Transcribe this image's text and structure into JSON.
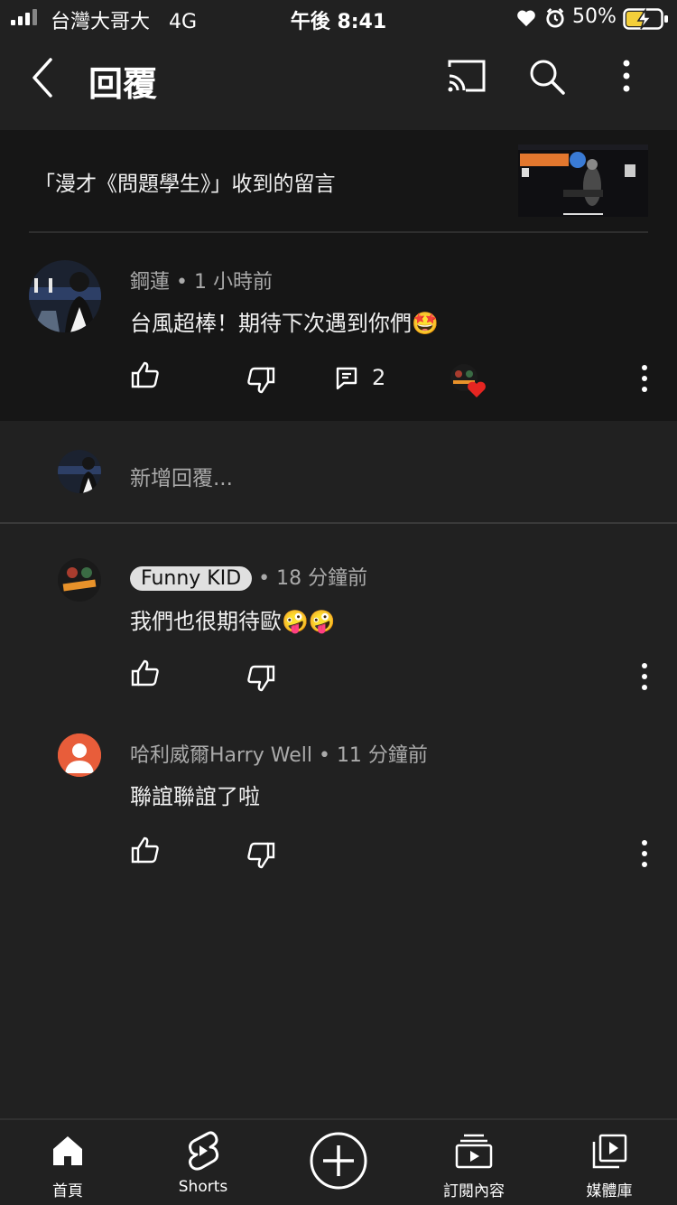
{
  "status_bar": {
    "carrier": "台灣大哥大",
    "network": "4G",
    "time": "午後 8:41",
    "battery": "50%"
  },
  "header": {
    "title": "回覆",
    "icons": [
      "back-arrow-icon",
      "cast-icon",
      "search-icon",
      "more-vertical-icon"
    ]
  },
  "video": {
    "title": "「漫才《問題學生》」收到的留言"
  },
  "main_comment": {
    "author": "鋼蓮",
    "time": "1 小時前",
    "text": "台風超棒！期待下次遇到你們🤩",
    "reply_count": "2"
  },
  "add_reply": {
    "placeholder": "新增回覆..."
  },
  "replies": [
    {
      "author": "Funny KID",
      "time": "18 分鐘前",
      "text": "我們也很期待歐🤪🤪"
    },
    {
      "author": "哈利威爾Harry Well",
      "time": "11 分鐘前",
      "text": "聯誼聯誼了啦"
    }
  ],
  "bottom_nav": {
    "items": [
      {
        "label": "首頁",
        "icon": "home-icon"
      },
      {
        "label": "Shorts",
        "icon": "shorts-icon"
      },
      {
        "label": "",
        "icon": "create-icon"
      },
      {
        "label": "訂閱內容",
        "icon": "subscriptions-icon"
      },
      {
        "label": "媒體庫",
        "icon": "library-icon"
      }
    ]
  },
  "colors": {
    "background": "#212121",
    "card": "#161616",
    "muted_text": "#aaaaaa",
    "heart": "#e52521",
    "avatar_orange": "#e85d3a"
  }
}
